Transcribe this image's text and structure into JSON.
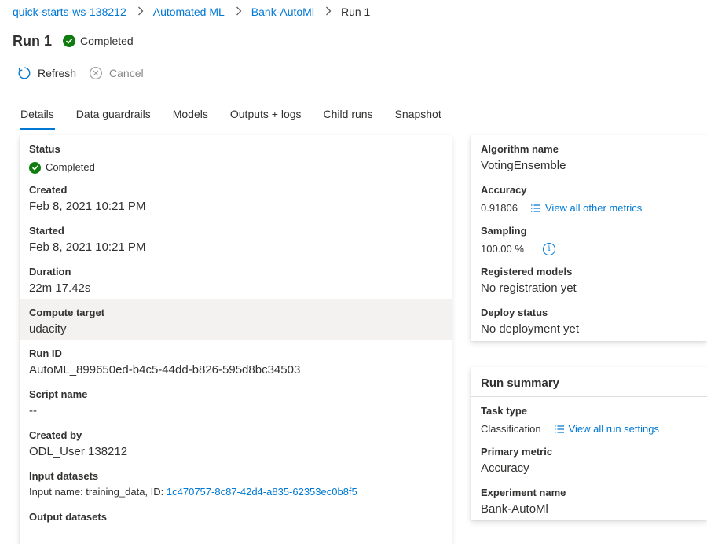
{
  "breadcrumb": {
    "items": [
      "quick-starts-ws-138212",
      "Automated ML",
      "Bank-AutoMl"
    ],
    "current": "Run 1"
  },
  "header": {
    "title": "Run 1",
    "status": "Completed"
  },
  "toolbar": {
    "refresh": "Refresh",
    "cancel": "Cancel"
  },
  "tabs": [
    "Details",
    "Data guardrails",
    "Models",
    "Outputs + logs",
    "Child runs",
    "Snapshot"
  ],
  "details": {
    "status_label": "Status",
    "status_value": "Completed",
    "created_label": "Created",
    "created_value": "Feb 8, 2021 10:21 PM",
    "started_label": "Started",
    "started_value": "Feb 8, 2021 10:21 PM",
    "duration_label": "Duration",
    "duration_value": "22m 17.42s",
    "compute_label": "Compute target",
    "compute_value": "udacity",
    "runid_label": "Run ID",
    "runid_value": "AutoML_899650ed-b4c5-44dd-b826-595d8bc34503",
    "script_label": "Script name",
    "script_value": "--",
    "createdby_label": "Created by",
    "createdby_value": "ODL_User 138212",
    "inputs_label": "Input datasets",
    "inputs_prefix": "Input name: training_data, ID:",
    "inputs_id": "1c470757-8c87-42d4-a835-62353ec0b8f5",
    "outputs_label": "Output datasets"
  },
  "algorithm": {
    "name_label": "Algorithm name",
    "name_value": "VotingEnsemble",
    "accuracy_label": "Accuracy",
    "accuracy_value": "0.91806",
    "metrics_link": "View all other metrics",
    "sampling_label": "Sampling",
    "sampling_value": "100.00 %",
    "registered_label": "Registered models",
    "registered_value": "No registration yet",
    "deploy_label": "Deploy status",
    "deploy_value": "No deployment yet"
  },
  "summary": {
    "title": "Run summary",
    "task_label": "Task type",
    "task_value": "Classification",
    "settings_link": "View all run settings",
    "metric_label": "Primary metric",
    "metric_value": "Accuracy",
    "experiment_label": "Experiment name",
    "experiment_value": "Bank-AutoMl"
  },
  "colors": {
    "accent": "#0078d4",
    "success": "#107c10"
  }
}
